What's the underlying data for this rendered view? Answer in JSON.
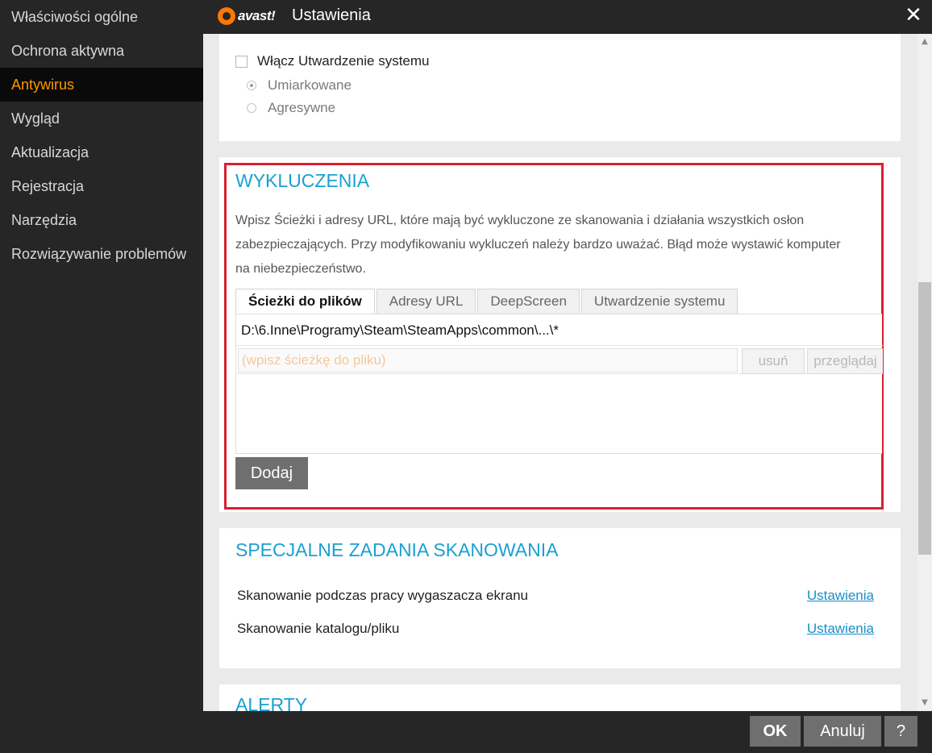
{
  "window": {
    "logo_text": "avast!",
    "title": "Ustawienia",
    "close_glyph": "✕"
  },
  "sidebar": {
    "items": [
      {
        "label": "Właściwości ogólne",
        "active": false
      },
      {
        "label": "Ochrona aktywna",
        "active": false
      },
      {
        "label": "Antywirus",
        "active": true
      },
      {
        "label": "Wygląd",
        "active": false
      },
      {
        "label": "Aktualizacja",
        "active": false
      },
      {
        "label": "Rejestracja",
        "active": false
      },
      {
        "label": "Narzędzia",
        "active": false
      },
      {
        "label": "Rozwiązywanie problemów",
        "active": false
      }
    ]
  },
  "hardening": {
    "checkbox_label": "Włącz Utwardzenie systemu",
    "checked": false,
    "options": [
      {
        "label": "Umiarkowane",
        "selected": true
      },
      {
        "label": "Agresywne",
        "selected": false
      }
    ]
  },
  "exclusions": {
    "title": "WYKLUCZENIA",
    "description": "Wpisz Ścieżki i adresy URL, które mają być wykluczone ze skanowania i działania wszystkich osłon zabezpieczających. Przy modyfikowaniu wykluczeń należy bardzo uważać. Błąd może wystawić komputer na niebezpieczeństwo.",
    "tabs": [
      {
        "label": "Ścieżki do plików",
        "active": true
      },
      {
        "label": "Adresy URL",
        "active": false
      },
      {
        "label": "DeepScreen",
        "active": false
      },
      {
        "label": "Utwardzenie systemu",
        "active": false
      }
    ],
    "paths": [
      "D:\\6.Inne\\Programy\\Steam\\SteamApps\\common\\...\\*"
    ],
    "input_placeholder": "(wpisz ścieżkę do pliku)",
    "remove_label": "usuń",
    "browse_label": "przeglądaj",
    "add_label": "Dodaj"
  },
  "special_scans": {
    "title": "SPECJALNE ZADANIA SKANOWANIA",
    "rows": [
      {
        "label": "Skanowanie podczas pracy wygaszacza ekranu",
        "link": "Ustawienia"
      },
      {
        "label": "Skanowanie katalogu/pliku",
        "link": "Ustawienia"
      }
    ]
  },
  "alerts": {
    "title": "ALERTY"
  },
  "footer": {
    "ok_label": "OK",
    "cancel_label": "Anuluj",
    "help_label": "?"
  },
  "colors": {
    "accent_orange": "#ff9600",
    "section_blue": "#1aa0d2",
    "highlight_red": "#d9202e",
    "dark_bg": "#262626"
  }
}
